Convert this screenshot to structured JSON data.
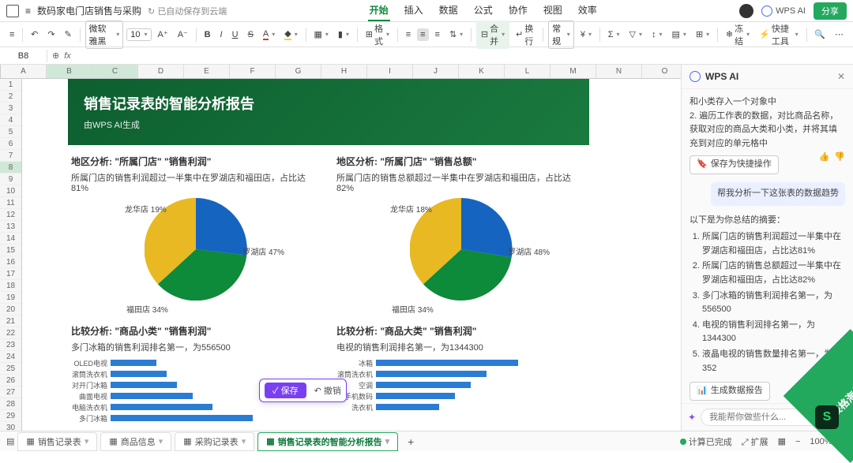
{
  "titlebar": {
    "filename": "数码家电门店销售与采购",
    "autosave": "已自动保存到云端",
    "menus": [
      "开始",
      "插入",
      "数据",
      "公式",
      "协作",
      "视图",
      "效率"
    ],
    "active_menu": "开始",
    "ai_label": "WPS AI",
    "share": "分享"
  },
  "toolbar": {
    "font": "微软雅黑",
    "font_size": "10",
    "format_label": "格式",
    "merge_label": "合并",
    "wrap_label": "换行",
    "general_label": "常规",
    "freeze_label": "冻结",
    "tools_label": "快捷工具"
  },
  "cellbar": {
    "ref": "B8",
    "fx": "fx"
  },
  "columns": [
    "A",
    "B",
    "C",
    "D",
    "E",
    "F",
    "G",
    "H",
    "I",
    "J",
    "K",
    "L",
    "M",
    "N",
    "O"
  ],
  "rows_count": 30,
  "selected_row": 8,
  "selected_cols": [
    "B",
    "C"
  ],
  "report": {
    "title": "销售记录表的智能分析报告",
    "subtitle": "由WPS AI生成",
    "chart1": {
      "title": "地区分析: \"所属门店\" \"销售利润\"",
      "sub": "所属门店的销售利润超过一半集中在罗湖店和福田店，占比达81%"
    },
    "chart2": {
      "title": "地区分析: \"所属门店\" \"销售总额\"",
      "sub": "所属门店的销售总额超过一半集中在罗湖店和福田店，占比达82%"
    },
    "chart3": {
      "title": "比较分析: \"商品小类\" \"销售利润\"",
      "sub": "多门冰箱的销售利润排名第一，为556500"
    },
    "chart4": {
      "title": "比较分析: \"商品大类\" \"销售利润\"",
      "sub": "电视的销售利润排名第一，为1344300"
    },
    "bar3_labels": [
      "OLED电视",
      "滚筒洗衣机",
      "对开门冰箱",
      "曲面电视",
      "电脑洗衣机",
      "多门冰箱"
    ],
    "bar4_labels": [
      "冰箱",
      "滚筒洗衣机",
      "空调",
      "手机数码",
      "洗衣机"
    ]
  },
  "chart_data": [
    {
      "type": "pie",
      "title": "地区分析: 所属门店 销售利润",
      "series": [
        {
          "name": "罗湖店",
          "value": 47
        },
        {
          "name": "福田店",
          "value": 34
        },
        {
          "name": "龙华店",
          "value": 19
        }
      ],
      "labels": {
        "luohu": "罗湖店 47%",
        "futian": "福田店 34%",
        "longhua": "龙华店 19%"
      }
    },
    {
      "type": "pie",
      "title": "地区分析: 所属门店 销售总额",
      "series": [
        {
          "name": "罗湖店",
          "value": 48
        },
        {
          "name": "福田店",
          "value": 34
        },
        {
          "name": "龙华店",
          "value": 18
        }
      ],
      "labels": {
        "luohu": "罗湖店 48%",
        "futian": "福田店 34%",
        "longhua": "龙华店 18%"
      }
    },
    {
      "type": "bar",
      "title": "比较分析: 商品小类 销售利润",
      "categories": [
        "OLED电视",
        "滚筒洗衣机",
        "对开门冰箱",
        "曲面电视",
        "电脑洗衣机",
        "多门冰箱"
      ],
      "values": [
        180000,
        220000,
        260000,
        320000,
        400000,
        556500
      ]
    },
    {
      "type": "bar",
      "title": "比较分析: 商品大类 销售利润",
      "categories": [
        "冰箱",
        "滚筒洗衣机",
        "空调",
        "手机数码",
        "洗衣机"
      ],
      "values": [
        900000,
        700000,
        600000,
        500000,
        400000
      ]
    }
  ],
  "save_popup": {
    "save": "保存",
    "cancel": "撤销"
  },
  "ai": {
    "title": "WPS AI",
    "context_line1": "和小类存入一个对象中",
    "context_line2": "2. 遍历工作表的数据，对比商品名称，获取对应的商品大类和小类，并将其填充到对应的单元格中",
    "save_quick": "保存为快捷操作",
    "user_msg": "帮我分析一下这张表的数据趋势",
    "summary_head": "以下是为你总结的摘要：",
    "summary": [
      "所属门店的销售利润超过一半集中在罗湖店和福田店，占比达81%",
      "所属门店的销售总额超过一半集中在罗湖店和福田店，占比达82%",
      "多门冰箱的销售利润排名第一，为556500",
      "电视的销售利润排名第一，为1344300",
      "液晶电视的销售数量排名第一，为352"
    ],
    "gen_report": "生成数据报告",
    "input_placeholder": "我能帮你做些什么..."
  },
  "sheets": {
    "tabs": [
      "销售记录表",
      "商品信息",
      "采购记录表",
      "销售记录表的智能分析报告"
    ],
    "active": 3,
    "add": "+"
  },
  "status": {
    "calc_done": "计算已完成",
    "expand": "扩展",
    "zoom": "100%"
  },
  "overseas": "表格海外版"
}
